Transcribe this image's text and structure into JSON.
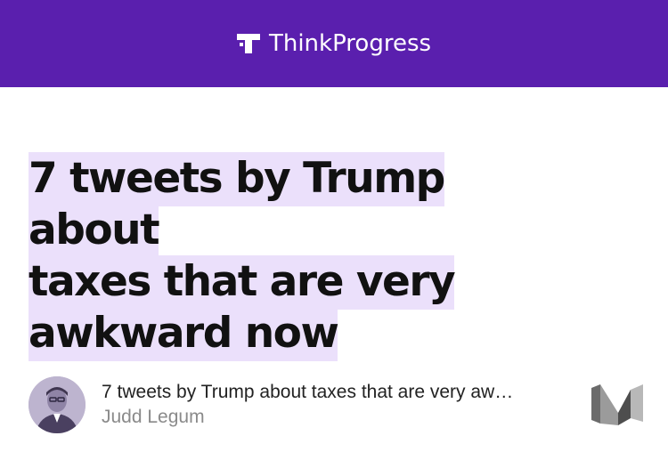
{
  "header": {
    "brand_name": "ThinkProgress",
    "background": "#5a1fae",
    "logo_icon": "thinkprogress-t-icon"
  },
  "article": {
    "headline_lines": [
      "7 tweets by Trump about",
      "taxes that are very",
      "awkward now"
    ],
    "highlight_color": "#ebe0fb"
  },
  "card": {
    "title": "7 tweets by Trump about taxes that are very aw…",
    "author": "Judd Legum",
    "avatar_icon": "author-avatar",
    "source_icon": "medium-logo-icon"
  }
}
